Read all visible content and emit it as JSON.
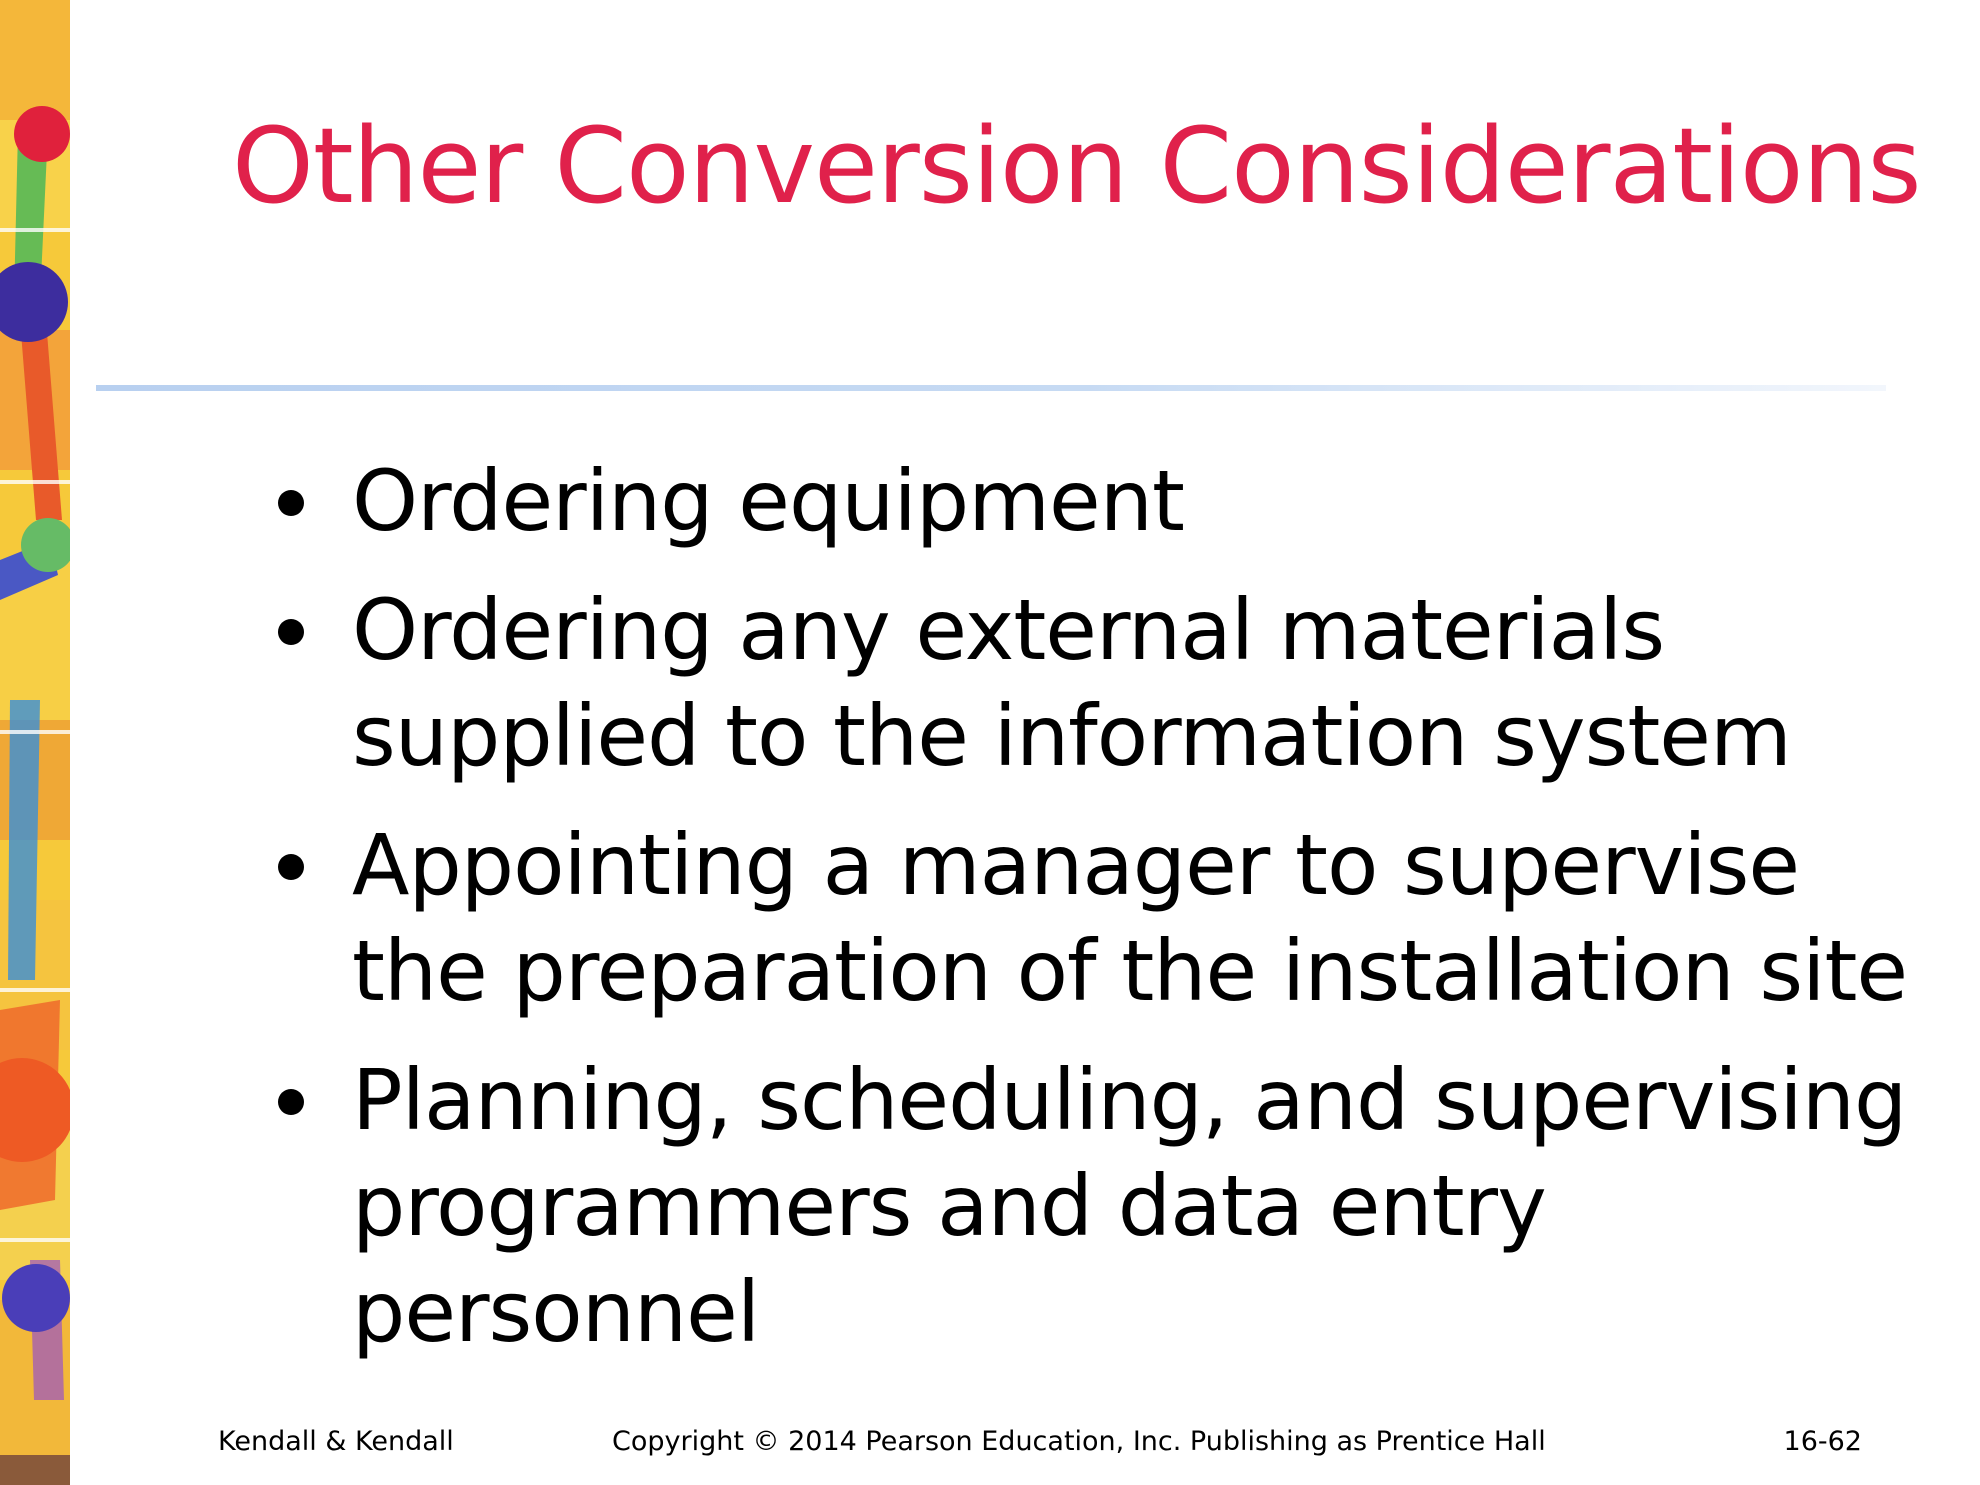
{
  "slide": {
    "title": "Other Conversion Considerations",
    "title_color": "#e0214b",
    "rule_color": "#c6daf3",
    "bullets": [
      "Ordering equipment",
      "Ordering any external materials supplied to the information system",
      "Appointing a manager to supervise the preparation of the installation site",
      "Planning, scheduling, and supervising programmers and data entry personnel"
    ]
  },
  "footer": {
    "left": "Kendall & Kendall",
    "center": "Copyright © 2014 Pearson Education, Inc. Publishing as Prentice Hall",
    "right": "16-62"
  }
}
